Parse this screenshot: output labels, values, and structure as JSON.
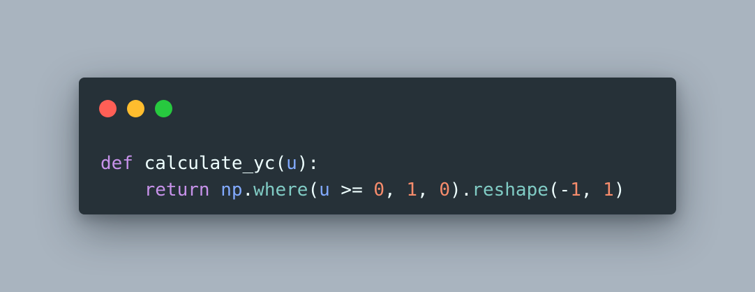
{
  "window": {
    "traffic_lights": {
      "close_color": "#ff5f56",
      "minimize_color": "#ffbd2e",
      "maximize_color": "#27c93f"
    }
  },
  "code": {
    "language": "python",
    "line1": {
      "kw_def": "def",
      "func_name": "calculate_yc",
      "paren_open": "(",
      "param": "u",
      "paren_close_colon": "):"
    },
    "line2": {
      "indent": "    ",
      "kw_return": "return",
      "module": "np",
      "dot1": ".",
      "method1": "where",
      "open1": "(",
      "arg_var": "u",
      "op": " >= ",
      "n0": "0",
      "sep1": ", ",
      "n1": "1",
      "sep2": ", ",
      "n2": "0",
      "close_dot": ").",
      "method2": "reshape",
      "open2": "(-",
      "n3": "1",
      "sep3": ", ",
      "n4": "1",
      "close2": ")"
    }
  }
}
